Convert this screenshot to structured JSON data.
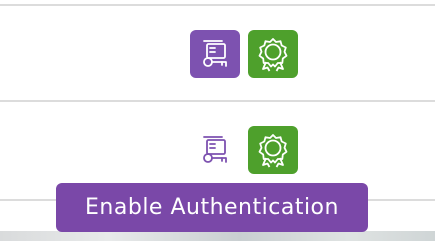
{
  "rows": [
    {
      "auth_icon": "key-card-icon",
      "auth_style": "filled",
      "cert_icon": "award-badge-icon"
    },
    {
      "auth_icon": "key-card-icon",
      "auth_style": "outline",
      "cert_icon": "award-badge-icon"
    }
  ],
  "tooltip": {
    "text": "Enable Authentication"
  },
  "colors": {
    "purple": "#7d52b0",
    "tooltip_bg": "#7a48a8",
    "green": "#4ea02c",
    "divider": "#dcdcdc"
  }
}
